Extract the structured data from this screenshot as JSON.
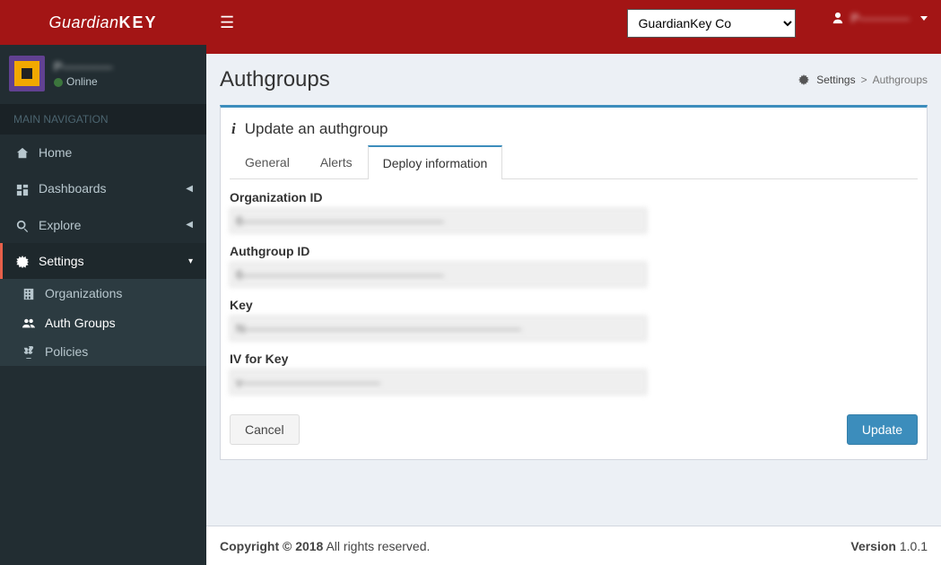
{
  "logo": {
    "part1": "Guardian",
    "part2": "KEY"
  },
  "header": {
    "org_selected": "GuardianKey Co",
    "user_name": "P————"
  },
  "sidebar": {
    "user": {
      "name": "P————",
      "status": "Online"
    },
    "nav_header": "MAIN NAVIGATION",
    "items": [
      {
        "icon": "home",
        "label": "Home",
        "expandable": false
      },
      {
        "icon": "dashboard",
        "label": "Dashboards",
        "expandable": true
      },
      {
        "icon": "search",
        "label": "Explore",
        "expandable": true
      },
      {
        "icon": "cogs",
        "label": "Settings",
        "expandable": true,
        "active": true
      }
    ],
    "settings_children": [
      {
        "icon": "building",
        "label": "Organizations"
      },
      {
        "icon": "users",
        "label": "Auth Groups",
        "active": true
      },
      {
        "icon": "scale",
        "label": "Policies"
      }
    ]
  },
  "page": {
    "title": "Authgroups",
    "breadcrumb": {
      "root": "Settings",
      "leaf": "Authgroups"
    },
    "card_title": "Update an authgroup",
    "tabs": [
      {
        "label": "General"
      },
      {
        "label": "Alerts"
      },
      {
        "label": "Deploy information",
        "active": true
      }
    ],
    "fields": {
      "org_id_label": "Organization ID",
      "org_id_value": "6————————————————",
      "authgroup_id_label": "Authgroup ID",
      "authgroup_id_value": "6————————————————",
      "key_label": "Key",
      "key_value": "N——————————————————————",
      "iv_label": "IV for Key",
      "iv_value": "v———————————"
    },
    "buttons": {
      "cancel": "Cancel",
      "update": "Update"
    }
  },
  "footer": {
    "copyright_bold": "Copyright © 2018",
    "copyright_rest": " All rights reserved.",
    "version_label": "Version",
    "version_value": " 1.0.1"
  }
}
